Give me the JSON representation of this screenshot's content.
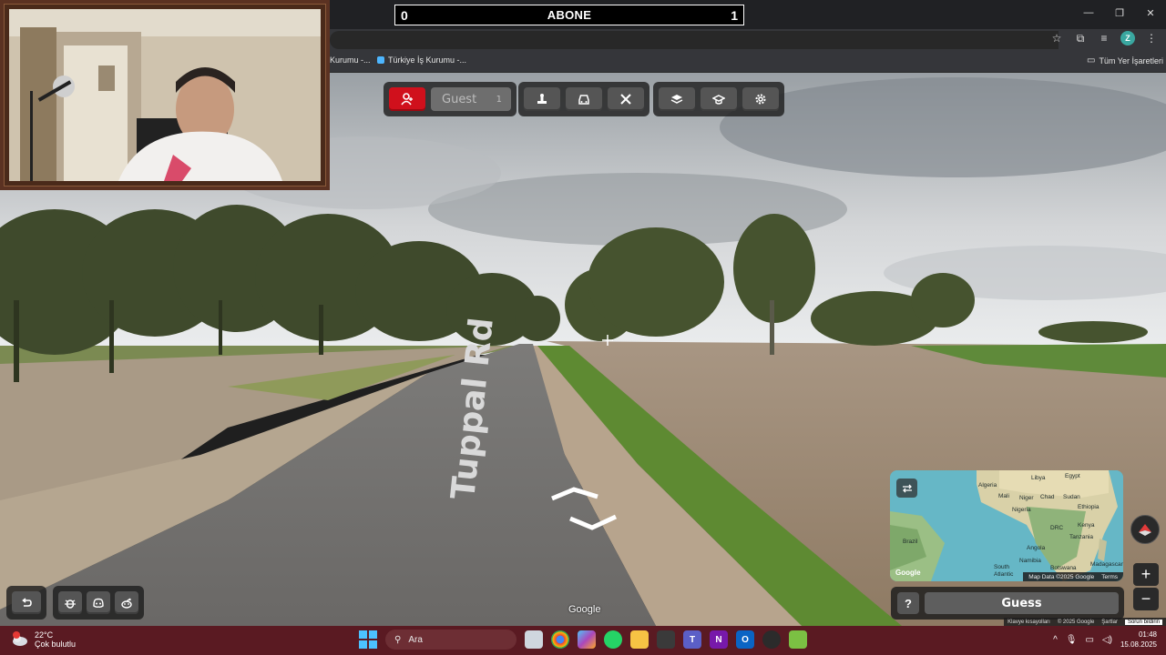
{
  "stream": {
    "counter": {
      "left_value": "0",
      "title": "ABONE",
      "right_value": "1"
    }
  },
  "browser": {
    "bookmarks": [
      {
        "label": "Kurumu -...",
        "color": "#8ab4f8"
      },
      {
        "label": "Türkiye İş Kurumu -...",
        "color": "#4db6ff"
      }
    ],
    "all_bookmarks_label": "Tüm Yer İşaretleri",
    "profile_letter": "Z",
    "window_controls": [
      "minimize-icon",
      "restore-icon",
      "close-icon"
    ]
  },
  "game": {
    "player": {
      "name": "Guest",
      "count": "1"
    },
    "top_tools": [
      "user-icon",
      "map-pin-icon",
      "car-icon",
      "close-cross-icon",
      "layers-icon",
      "graduation-cap-icon",
      "gear-icon"
    ],
    "bottom_tools": [
      "undo-icon",
      "bug-icon",
      "discord-icon",
      "reddit-icon"
    ],
    "street_label": "Tuppal Rd",
    "google_watermark": "Google",
    "guess_button": "Guess",
    "help_button": "?",
    "zoom_in": "+",
    "zoom_out": "−"
  },
  "minimap": {
    "labels": [
      "Algeria",
      "Libya",
      "Egypt",
      "Mali",
      "Niger",
      "Chad",
      "Sudan",
      "Ethiopia",
      "Nigeria",
      "DRC",
      "Kenya",
      "Tanzania",
      "Angola",
      "Namibia",
      "Botswana",
      "Madagascar",
      "Brazil",
      "South",
      "Atlantic"
    ],
    "attribution": "Map Data ©2025 Google",
    "terms": "Terms"
  },
  "streetview_footer": {
    "shortcuts": "Klavye kısayolları",
    "copyright": "© 2025 Google",
    "terms": "Şartlar",
    "report": "Sorun bildirin"
  },
  "taskbar": {
    "weather_temp": "22°C",
    "weather_desc": "Çok bulutlu",
    "weather_badge": "1",
    "search_placeholder": "Ara",
    "time": "01:48",
    "date": "15.08.2025"
  }
}
